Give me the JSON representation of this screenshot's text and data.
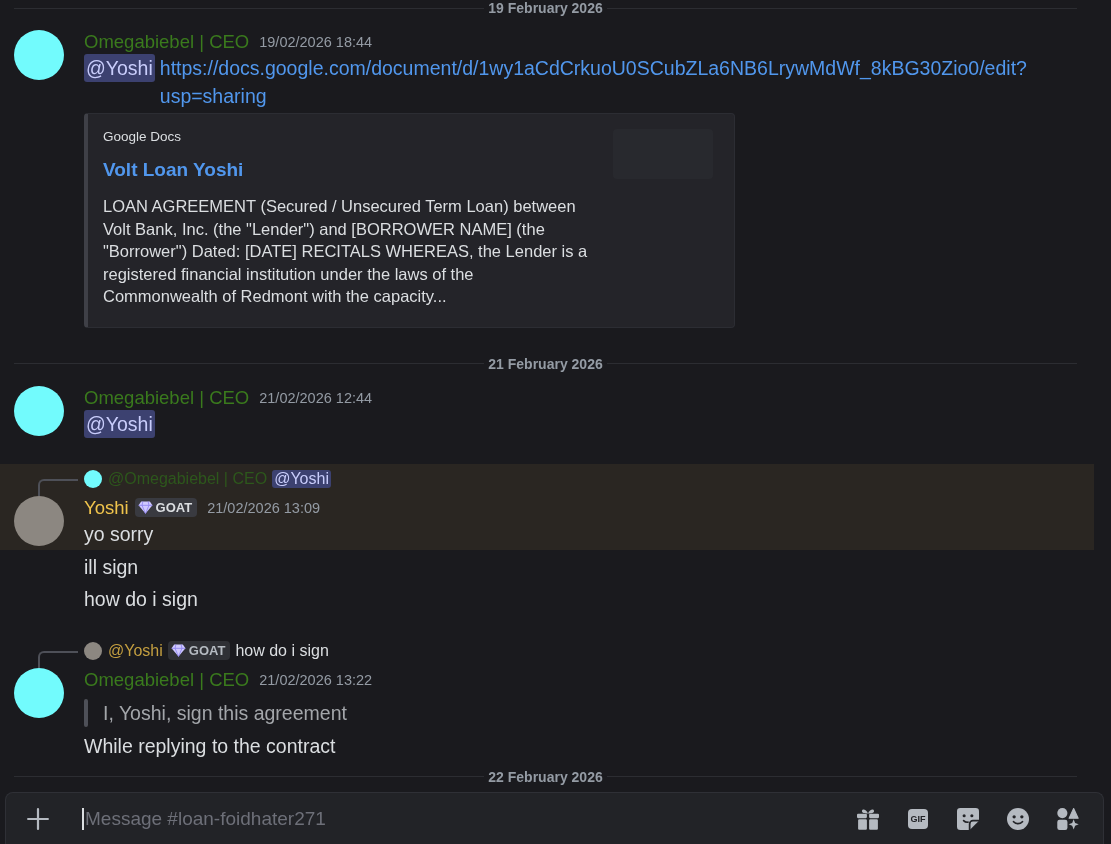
{
  "feed": [
    {
      "kind": "date_divider",
      "label": "19 February 2026"
    },
    {
      "kind": "message",
      "highlighted": false,
      "avatar": {
        "kind": "plain",
        "color": "#72fbfd"
      },
      "author": {
        "name": "Omegabiebel | CEO",
        "color": "#3a7a1d"
      },
      "timestamp": "19/02/2026 18:44",
      "body": [
        {
          "kind": "line",
          "parts": [
            {
              "kind": "mention",
              "text": "@Yoshi"
            },
            {
              "kind": "link",
              "text": "https://docs.google.com/document/d/1wy1aCdCrkuoU0SCubZLa6NB6LrywMdWf_8kBG30Zio0/edit?usp=sharing"
            }
          ]
        }
      ],
      "embed": {
        "provider": "Google Docs",
        "title": "Volt Loan Yoshi",
        "description": "LOAN AGREEMENT (Secured / Unsecured Term Loan) between Volt Bank, Inc. (the \"Lender\") and [BORROWER NAME] (the \"Borrower\") Dated: [DATE] RECITALS WHEREAS, the Lender is a registered financial institution under the laws of the Commonwealth of Redmont with the capacity..."
      }
    },
    {
      "kind": "date_divider",
      "label": "21 February 2026"
    },
    {
      "kind": "message",
      "highlighted": false,
      "avatar": {
        "kind": "plain",
        "color": "#72fbfd"
      },
      "author": {
        "name": "Omegabiebel | CEO",
        "color": "#3a7a1d"
      },
      "timestamp": "21/02/2026 12:44",
      "body": [
        {
          "kind": "line",
          "parts": [
            {
              "kind": "mention",
              "text": "@Yoshi"
            }
          ]
        }
      ]
    },
    {
      "kind": "message",
      "highlighted": true,
      "reply_to": {
        "avatar": {
          "kind": "plain",
          "color": "#72fbfd"
        },
        "author": {
          "name": "@Omegabiebel | CEO",
          "color": "#2d571c"
        },
        "parts": [
          {
            "kind": "mention",
            "text": "@Yoshi"
          }
        ]
      },
      "avatar": {
        "kind": "photo"
      },
      "author": {
        "name": "Yoshi",
        "color": "#f0c44c",
        "tag": "GOAT"
      },
      "timestamp": "21/02/2026 13:09",
      "body": [
        {
          "kind": "line",
          "parts": [
            {
              "kind": "text",
              "text": "yo sorry"
            }
          ]
        }
      ]
    },
    {
      "kind": "followup",
      "highlighted": false,
      "text": "ill sign"
    },
    {
      "kind": "followup",
      "highlighted": false,
      "text": "how do i sign"
    },
    {
      "kind": "message",
      "highlighted": false,
      "reply_to": {
        "avatar": {
          "kind": "photo"
        },
        "author": {
          "name": "@Yoshi",
          "color": "#c49f40",
          "tag": "GOAT"
        },
        "parts": [
          {
            "kind": "text",
            "text": "how do i sign"
          }
        ]
      },
      "avatar": {
        "kind": "plain",
        "color": "#72fbfd"
      },
      "author": {
        "name": "Omegabiebel | CEO",
        "color": "#3a7a1d"
      },
      "timestamp": "21/02/2026 13:22",
      "body": [
        {
          "kind": "quote",
          "parts": [
            {
              "kind": "text",
              "text": "I, Yoshi, sign this agreement"
            }
          ]
        },
        {
          "kind": "line",
          "parts": [
            {
              "kind": "text",
              "text": "While replying to the contract"
            }
          ]
        }
      ]
    },
    {
      "kind": "date_divider",
      "label": "22 February 2026"
    }
  ],
  "composer": {
    "placeholder": "Message #loan-foidhater271",
    "gif_label": "GIF"
  }
}
